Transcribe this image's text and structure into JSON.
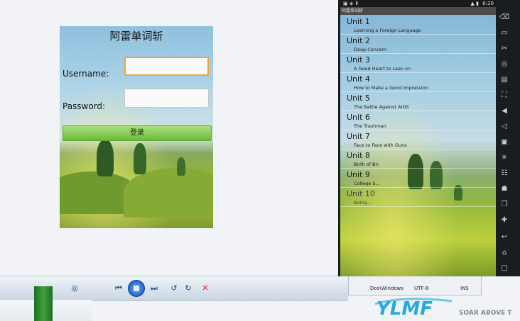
{
  "login": {
    "title": "阿雷单词斩",
    "username_label": "Username:",
    "password_label": "Password:",
    "login_button": "登录"
  },
  "emulator": {
    "status_time": "6:20",
    "app_title": "阿雷单词斩",
    "units": [
      {
        "name": "Unit 1",
        "desc": "Learning a Foreign Language"
      },
      {
        "name": "Unit 2",
        "desc": "Deep Concern"
      },
      {
        "name": "Unit 3",
        "desc": "A Good Heart to Lean on"
      },
      {
        "name": "Unit 4",
        "desc": "How to Make a Good Impression"
      },
      {
        "name": "Unit 5",
        "desc": "The Battle Against AIDS"
      },
      {
        "name": "Unit 6",
        "desc": "The Trashman"
      },
      {
        "name": "Unit 7",
        "desc": "Face to Face with Guns"
      },
      {
        "name": "Unit 8",
        "desc": "Birth of Bri"
      },
      {
        "name": "Unit 9",
        "desc": "College S..."
      },
      {
        "name": "Unit 10",
        "desc": "Being..."
      }
    ]
  },
  "editor_status": {
    "line_ending": "Dos\\Windows",
    "encoding": "UTF-8",
    "mode": "INS"
  },
  "watermark": {
    "brand": "YLMF",
    "tagline": "SOAR ABOVE T"
  },
  "colors": {
    "login_button": "#6bb93b",
    "focus_border": "#f2a232",
    "stop_button": "#d22828"
  }
}
